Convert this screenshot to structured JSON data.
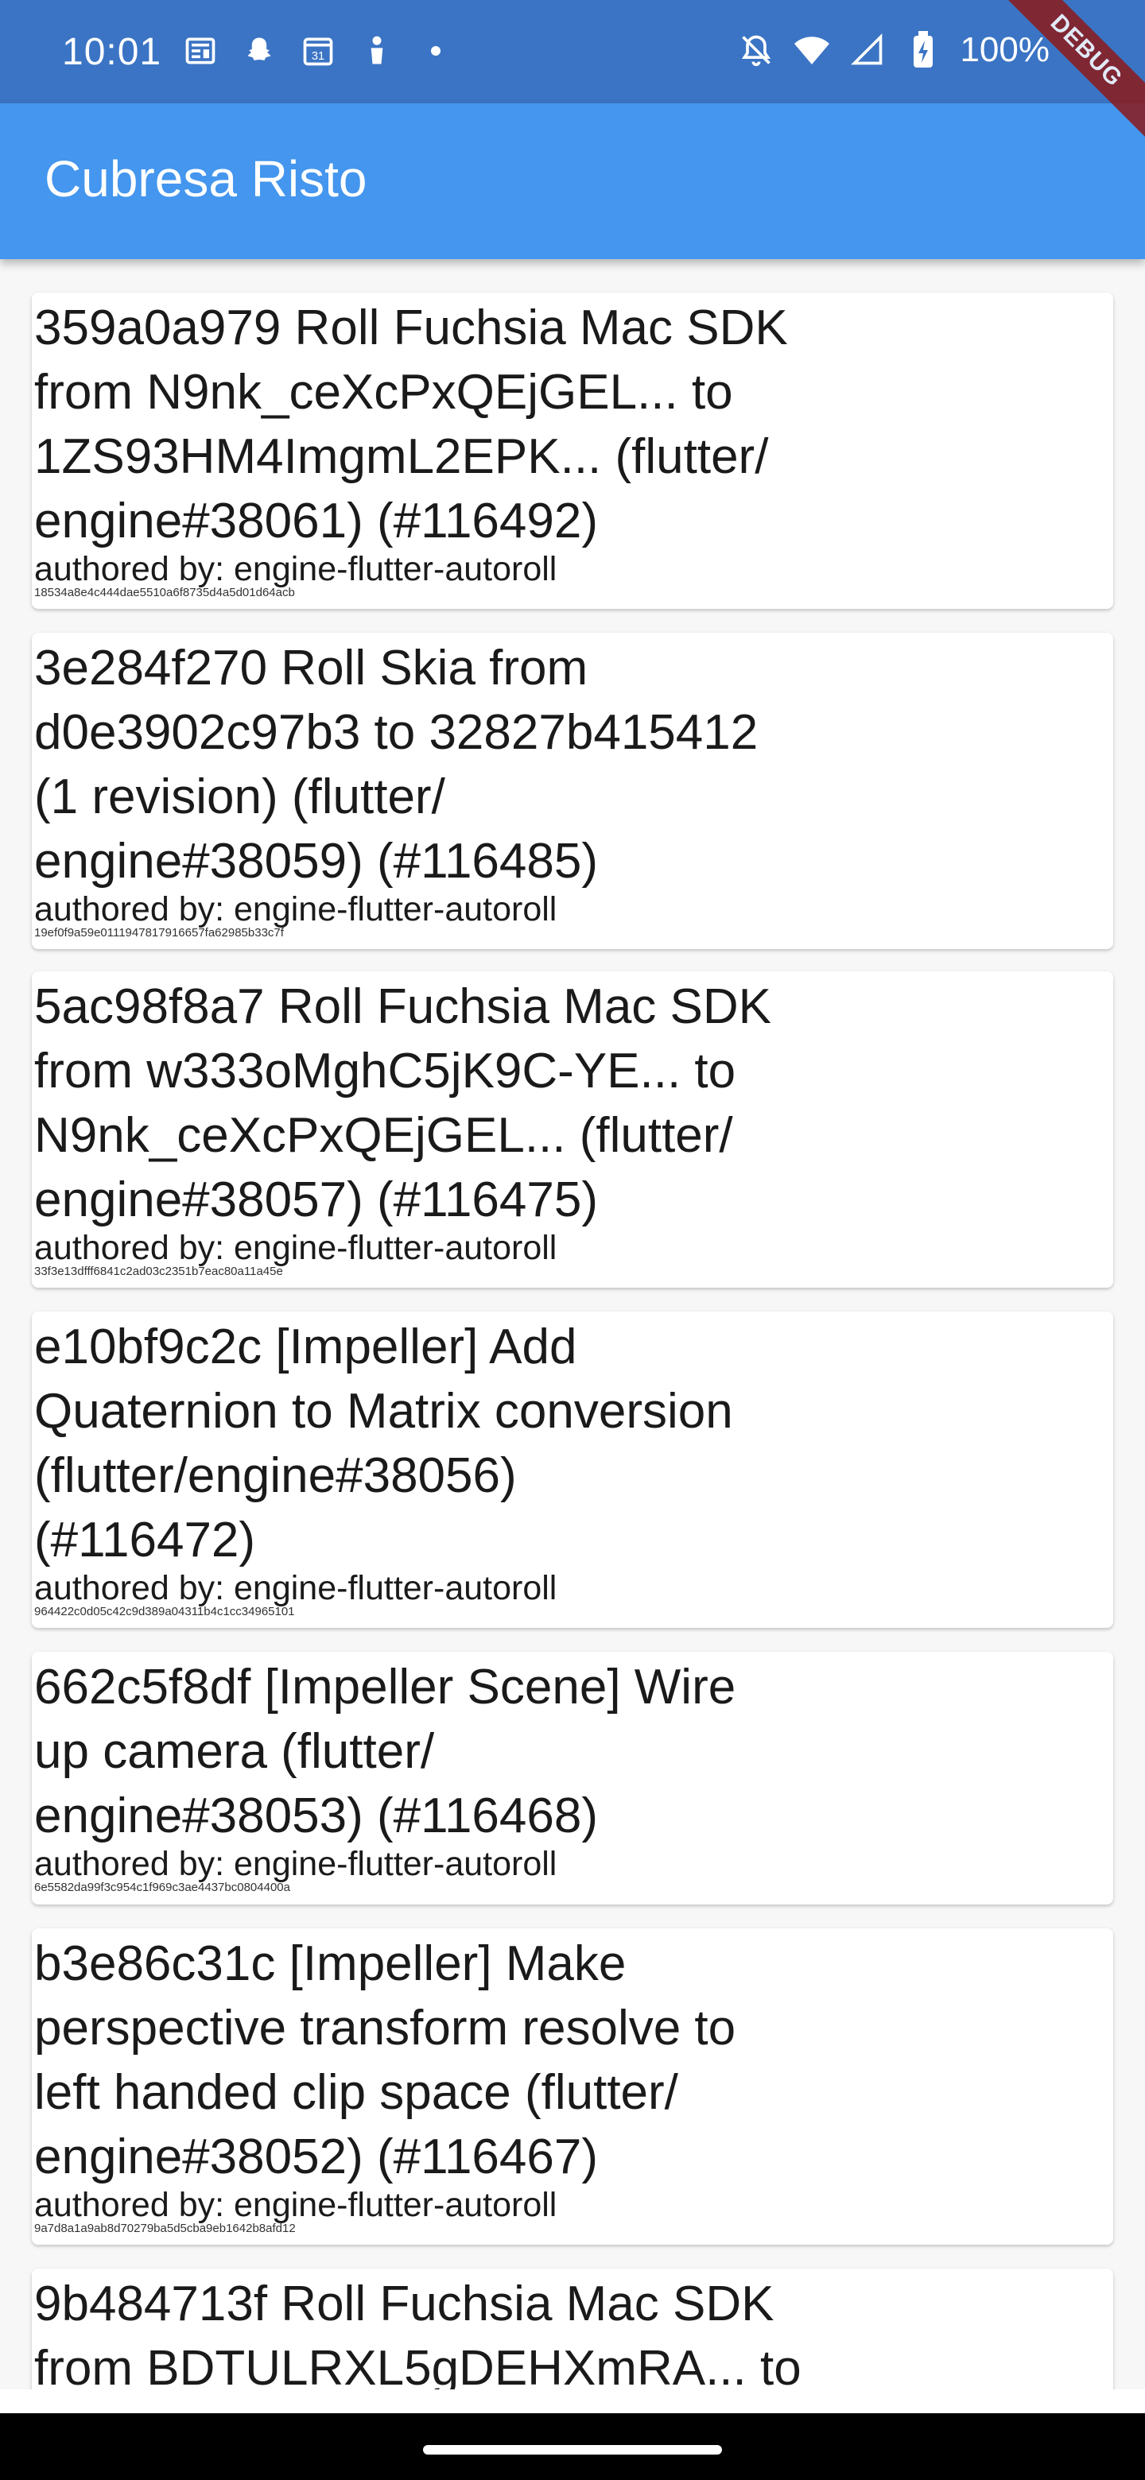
{
  "status_bar": {
    "time": "10:01",
    "left_icons": [
      "news-icon",
      "snapchat-icon",
      "calendar-icon",
      "figure-icon",
      "dot-icon"
    ],
    "calendar_day": "31",
    "right_icons": [
      "notifications-off-icon",
      "wifi-icon",
      "signal-icon",
      "battery-icon"
    ],
    "battery_text": "100%"
  },
  "debug_banner": "DEBUG",
  "app_bar": {
    "title": "Cubresa Risto"
  },
  "commits": [
    {
      "title": "359a0a979 Roll Fuchsia Mac SDK\nfrom N9nk_ceXcPxQEjGEL... to\n1ZS93HM4ImgmL2EPK... (flutter/\nengine#38061) (#116492)",
      "author": "authored by: engine-flutter-autoroll",
      "sha": "18534a8e4c444dae5510a6f8735d4a5d01d64acb"
    },
    {
      "title": "3e284f270 Roll Skia from\nd0e3902c97b3 to 32827b415412\n(1 revision) (flutter/\nengine#38059) (#116485)",
      "author": "authored by: engine-flutter-autoroll",
      "sha": "19ef0f9a59e0111947817916657fa62985b33c7f"
    },
    {
      "title": "5ac98f8a7 Roll Fuchsia Mac SDK\nfrom w333oMghC5jK9C-YE... to\nN9nk_ceXcPxQEjGEL... (flutter/\nengine#38057) (#116475)",
      "author": "authored by: engine-flutter-autoroll",
      "sha": "33f3e13dfff6841c2ad03c2351b7eac80a11a45e"
    },
    {
      "title": "e10bf9c2c [Impeller] Add\nQuaternion to Matrix conversion\n(flutter/engine#38056)\n(#116472)",
      "author": "authored by: engine-flutter-autoroll",
      "sha": "964422c0d05c42c9d389a04311b4c1cc34965101"
    },
    {
      "title": "662c5f8df [Impeller Scene] Wire\nup camera (flutter/\nengine#38053) (#116468)",
      "author": "authored by: engine-flutter-autoroll",
      "sha": "6e5582da99f3c954c1f969c3ae4437bc0804400a"
    },
    {
      "title": "b3e86c31c [Impeller] Make\nperspective transform resolve to\nleft handed clip space (flutter/\nengine#38052) (#116467)",
      "author": "authored by: engine-flutter-autoroll",
      "sha": "9a7d8a1a9ab8d70279ba5d5cba9eb1642b8afd12"
    },
    {
      "title": "9b484713f Roll Fuchsia Mac SDK\nfrom BDTULRXL5gDEHXmRA... to",
      "author": "",
      "sha": ""
    }
  ]
}
